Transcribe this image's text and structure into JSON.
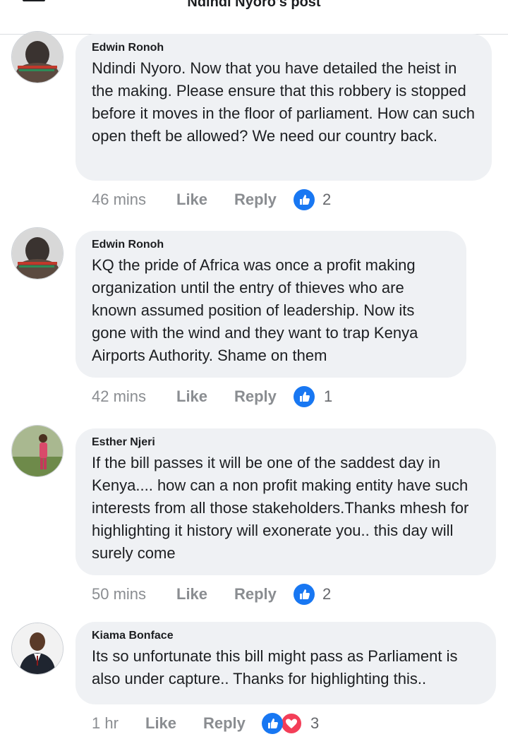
{
  "header": {
    "title": "Ndindi Nyoro's post"
  },
  "comments": [
    {
      "author": "Edwin Ronoh",
      "text": "Ndindi Nyoro. Now that you have detailed the heist in the making. Please ensure that this robbery is stopped before it moves in the floor of parliament. How can such open theft be allowed? We need our country back.",
      "time": "46 mins",
      "like_label": "Like",
      "reply_label": "Reply",
      "reaction_count": "2"
    },
    {
      "author": "Edwin Ronoh",
      "text": "KQ the pride of Africa was once a profit making organization until the entry of thieves who are known assumed position of leadership. Now its gone with the wind and they want to trap Kenya Airports Authority. Shame on them",
      "time": "42 mins",
      "like_label": "Like",
      "reply_label": "Reply",
      "reaction_count": "1"
    },
    {
      "author": "Esther Njeri",
      "text": "If the bill passes it will be one of the saddest day in Kenya.... how can a non profit making entity have such interests from all those stakeholders.Thanks mhesh for highlighting it history will exonerate you.. this day will surely come",
      "time": "50 mins",
      "like_label": "Like",
      "reply_label": "Reply",
      "reaction_count": "2"
    },
    {
      "author": "Kiama Bonface",
      "text": "Its so unfortunate this bill might pass as Parliament is also under capture.. Thanks for highlighting this..",
      "time": "1 hr",
      "like_label": "Like",
      "reply_label": "Reply",
      "reaction_count": "3"
    }
  ],
  "colors": {
    "bubble": "#eff1f4",
    "like_blue": "#1877f2",
    "love_red": "#f33e58",
    "meta_grey": "#8a8d91"
  }
}
